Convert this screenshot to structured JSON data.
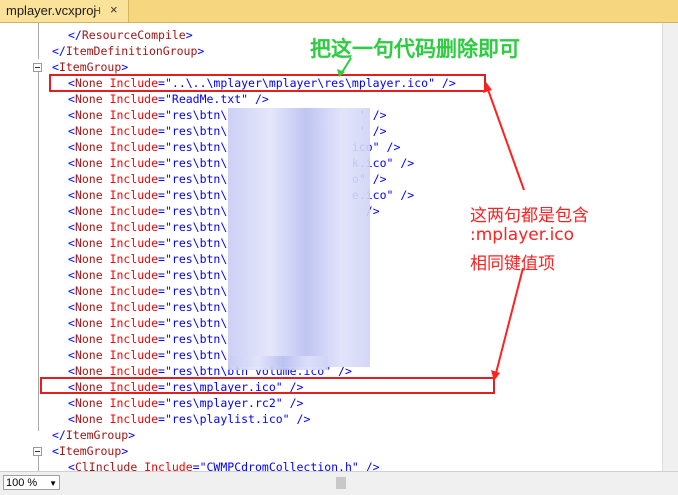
{
  "tab": {
    "title": "mplayer.vcxproj",
    "pin": "⊣",
    "close": "×"
  },
  "code": {
    "lines": [
      {
        "indent": 3,
        "parts": [
          [
            "br",
            "</"
          ],
          [
            "tag",
            "ResourceCompile"
          ],
          [
            "br",
            ">"
          ]
        ]
      },
      {
        "indent": 2,
        "parts": [
          [
            "br",
            "</"
          ],
          [
            "tag",
            "ItemDefinitionGroup"
          ],
          [
            "br",
            ">"
          ]
        ]
      },
      {
        "indent": 2,
        "parts": [
          [
            "br",
            "<"
          ],
          [
            "tag",
            "ItemGroup"
          ],
          [
            "br",
            ">"
          ]
        ]
      },
      {
        "indent": 3,
        "parts": [
          [
            "br",
            "<"
          ],
          [
            "tag",
            "None"
          ],
          [
            "attr",
            " Include"
          ],
          [
            "br",
            "="
          ],
          [
            "val",
            "\"..\\..\\mplayer\\mplayer\\res\\mplayer.ico\""
          ],
          [
            "br",
            " />"
          ]
        ]
      },
      {
        "indent": 3,
        "parts": [
          [
            "br",
            "<"
          ],
          [
            "tag",
            "None"
          ],
          [
            "attr",
            " Include"
          ],
          [
            "br",
            "="
          ],
          [
            "val",
            "\"ReadMe.txt\""
          ],
          [
            "br",
            " />"
          ]
        ]
      },
      {
        "indent": 3,
        "parts": [
          [
            "br",
            "<"
          ],
          [
            "tag",
            "None"
          ],
          [
            "attr",
            " Include"
          ],
          [
            "br",
            "="
          ],
          [
            "val",
            "\"res\\btn\\                   '"
          ],
          [
            "br",
            " />"
          ]
        ]
      },
      {
        "indent": 3,
        "parts": [
          [
            "br",
            "<"
          ],
          [
            "tag",
            "None"
          ],
          [
            "attr",
            " Include"
          ],
          [
            "br",
            "="
          ],
          [
            "val",
            "\"res\\btn\\                   '"
          ],
          [
            "br",
            " />"
          ]
        ]
      },
      {
        "indent": 3,
        "parts": [
          [
            "br",
            "<"
          ],
          [
            "tag",
            "None"
          ],
          [
            "attr",
            " Include"
          ],
          [
            "br",
            "="
          ],
          [
            "val",
            "\"res\\btn\\                  ico\""
          ],
          [
            "br",
            " />"
          ]
        ]
      },
      {
        "indent": 3,
        "parts": [
          [
            "br",
            "<"
          ],
          [
            "tag",
            "None"
          ],
          [
            "attr",
            " Include"
          ],
          [
            "br",
            "="
          ],
          [
            "val",
            "\"res\\btn\\                  k.ico\""
          ],
          [
            "br",
            " />"
          ]
        ]
      },
      {
        "indent": 3,
        "parts": [
          [
            "br",
            "<"
          ],
          [
            "tag",
            "None"
          ],
          [
            "attr",
            " Include"
          ],
          [
            "br",
            "="
          ],
          [
            "val",
            "\"res\\btn\\                  o\""
          ],
          [
            "br",
            " />"
          ]
        ]
      },
      {
        "indent": 3,
        "parts": [
          [
            "br",
            "<"
          ],
          [
            "tag",
            "None"
          ],
          [
            "attr",
            " Include"
          ],
          [
            "br",
            "="
          ],
          [
            "val",
            "\"res\\btn\\                  e.ico\""
          ],
          [
            "br",
            " />"
          ]
        ]
      },
      {
        "indent": 3,
        "parts": [
          [
            "br",
            "<"
          ],
          [
            "tag",
            "None"
          ],
          [
            "attr",
            " Include"
          ],
          [
            "br",
            "="
          ],
          [
            "val",
            "\"res\\btn\\                   "
          ],
          [
            "br",
            " />"
          ]
        ]
      },
      {
        "indent": 3,
        "parts": [
          [
            "br",
            "<"
          ],
          [
            "tag",
            "None"
          ],
          [
            "attr",
            " Include"
          ],
          [
            "br",
            "="
          ],
          [
            "val",
            "\"res\\btn\\"
          ]
        ]
      },
      {
        "indent": 3,
        "parts": [
          [
            "br",
            "<"
          ],
          [
            "tag",
            "None"
          ],
          [
            "attr",
            " Include"
          ],
          [
            "br",
            "="
          ],
          [
            "val",
            "\"res\\btn\\"
          ]
        ]
      },
      {
        "indent": 3,
        "parts": [
          [
            "br",
            "<"
          ],
          [
            "tag",
            "None"
          ],
          [
            "attr",
            " Include"
          ],
          [
            "br",
            "="
          ],
          [
            "val",
            "\"res\\btn\\"
          ]
        ]
      },
      {
        "indent": 3,
        "parts": [
          [
            "br",
            "<"
          ],
          [
            "tag",
            "None"
          ],
          [
            "attr",
            " Include"
          ],
          [
            "br",
            "="
          ],
          [
            "val",
            "\"res\\btn\\"
          ]
        ]
      },
      {
        "indent": 3,
        "parts": [
          [
            "br",
            "<"
          ],
          [
            "tag",
            "None"
          ],
          [
            "attr",
            " Include"
          ],
          [
            "br",
            "="
          ],
          [
            "val",
            "\"res\\btn\\"
          ]
        ]
      },
      {
        "indent": 3,
        "parts": [
          [
            "br",
            "<"
          ],
          [
            "tag",
            "None"
          ],
          [
            "attr",
            " Include"
          ],
          [
            "br",
            "="
          ],
          [
            "val",
            "\"res\\btn\\"
          ]
        ]
      },
      {
        "indent": 3,
        "parts": [
          [
            "br",
            "<"
          ],
          [
            "tag",
            "None"
          ],
          [
            "attr",
            " Include"
          ],
          [
            "br",
            "="
          ],
          [
            "val",
            "\"res\\btn\\"
          ]
        ]
      },
      {
        "indent": 3,
        "parts": [
          [
            "br",
            "<"
          ],
          [
            "tag",
            "None"
          ],
          [
            "attr",
            " Include"
          ],
          [
            "br",
            "="
          ],
          [
            "val",
            "\"res\\btn\\"
          ]
        ]
      },
      {
        "indent": 3,
        "parts": [
          [
            "br",
            "<"
          ],
          [
            "tag",
            "None"
          ],
          [
            "attr",
            " Include"
          ],
          [
            "br",
            "="
          ],
          [
            "val",
            "\"res\\btn\\"
          ]
        ]
      },
      {
        "indent": 3,
        "parts": [
          [
            "br",
            "<"
          ],
          [
            "tag",
            "None"
          ],
          [
            "attr",
            " Include"
          ],
          [
            "br",
            "="
          ],
          [
            "val",
            "\"res\\btn\\btn_volume.ico\""
          ],
          [
            "br",
            " />"
          ]
        ]
      },
      {
        "indent": 3,
        "parts": [
          [
            "br",
            "<"
          ],
          [
            "tag",
            "None"
          ],
          [
            "attr",
            " Include"
          ],
          [
            "br",
            "="
          ],
          [
            "val",
            "\"res\\mplayer.ico\""
          ],
          [
            "br",
            " />"
          ]
        ]
      },
      {
        "indent": 3,
        "parts": [
          [
            "br",
            "<"
          ],
          [
            "tag",
            "None"
          ],
          [
            "attr",
            " Include"
          ],
          [
            "br",
            "="
          ],
          [
            "val",
            "\"res\\mplayer.rc2\""
          ],
          [
            "br",
            " />"
          ]
        ]
      },
      {
        "indent": 3,
        "parts": [
          [
            "br",
            "<"
          ],
          [
            "tag",
            "None"
          ],
          [
            "attr",
            " Include"
          ],
          [
            "br",
            "="
          ],
          [
            "val",
            "\"res\\playlist.ico\""
          ],
          [
            "br",
            " />"
          ]
        ]
      },
      {
        "indent": 2,
        "parts": [
          [
            "br",
            "</"
          ],
          [
            "tag",
            "ItemGroup"
          ],
          [
            "br",
            ">"
          ]
        ]
      },
      {
        "indent": 2,
        "parts": [
          [
            "br",
            "<"
          ],
          [
            "tag",
            "ItemGroup"
          ],
          [
            "br",
            ">"
          ]
        ]
      },
      {
        "indent": 3,
        "parts": [
          [
            "br",
            "<"
          ],
          [
            "tag",
            "ClInclude"
          ],
          [
            "attr",
            " Include"
          ],
          [
            "br",
            "="
          ],
          [
            "val",
            "\"CWMPCdromCollection.h\""
          ],
          [
            "br",
            " />"
          ]
        ]
      }
    ]
  },
  "annotations": {
    "delete_note": "把这一句代码删除即可",
    "side_note_1": "这两句都是包含",
    "side_note_2": ":mplayer.ico",
    "side_note_3": "相同键值项"
  },
  "status": {
    "zoom": "100 %",
    "zoom_arrow": "▼"
  },
  "colors": {
    "tag": "#a31515",
    "bracket": "#0000ff",
    "attribute": "#ff0000",
    "value": "#0000ff",
    "tab": "#fbe29a",
    "annotation_red": "#ff2020",
    "annotation_green": "#2ecc40"
  }
}
